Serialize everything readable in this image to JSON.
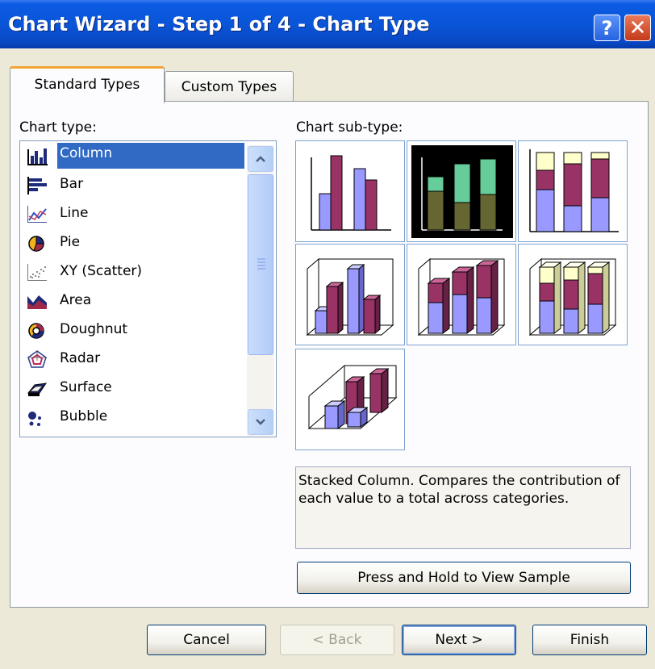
{
  "window": {
    "title": "Chart Wizard - Step 1 of 4 - Chart Type",
    "help_label": "?",
    "close_label": "✕"
  },
  "tabs": [
    {
      "label": "Standard Types",
      "active": true
    },
    {
      "label": "Custom Types",
      "active": false
    }
  ],
  "chart_type": {
    "label": "Chart type:",
    "items": [
      {
        "label": "Column",
        "icon": "column-chart-icon",
        "selected": true
      },
      {
        "label": "Bar",
        "icon": "bar-chart-icon"
      },
      {
        "label": "Line",
        "icon": "line-chart-icon"
      },
      {
        "label": "Pie",
        "icon": "pie-chart-icon"
      },
      {
        "label": "XY (Scatter)",
        "icon": "scatter-chart-icon"
      },
      {
        "label": "Area",
        "icon": "area-chart-icon"
      },
      {
        "label": "Doughnut",
        "icon": "doughnut-chart-icon"
      },
      {
        "label": "Radar",
        "icon": "radar-chart-icon"
      },
      {
        "label": "Surface",
        "icon": "surface-chart-icon"
      },
      {
        "label": "Bubble",
        "icon": "bubble-chart-icon"
      }
    ]
  },
  "subtype": {
    "label": "Chart sub-type:",
    "selected": "stacked-column",
    "description": "Stacked Column. Compares the contribution of each value to a total across categories.",
    "tiles": [
      {
        "id": "clustered-column"
      },
      {
        "id": "stacked-column"
      },
      {
        "id": "100-percent-stacked-column"
      },
      {
        "id": "3d-clustered-column"
      },
      {
        "id": "3d-stacked-column"
      },
      {
        "id": "3d-100-percent-stacked-column"
      },
      {
        "id": "3d-column"
      }
    ]
  },
  "buttons": {
    "press_hold": "Press and Hold to View Sample",
    "cancel": "Cancel",
    "back": "< Back",
    "next": "Next >",
    "finish": "Finish"
  },
  "colors": {
    "periwinkle": "#9999ff",
    "plum": "#993366",
    "cream": "#ffffcc",
    "olive": "#666633",
    "mint": "#66cc99",
    "selection": "#316ac5",
    "titlebar": "#0a55d8"
  }
}
